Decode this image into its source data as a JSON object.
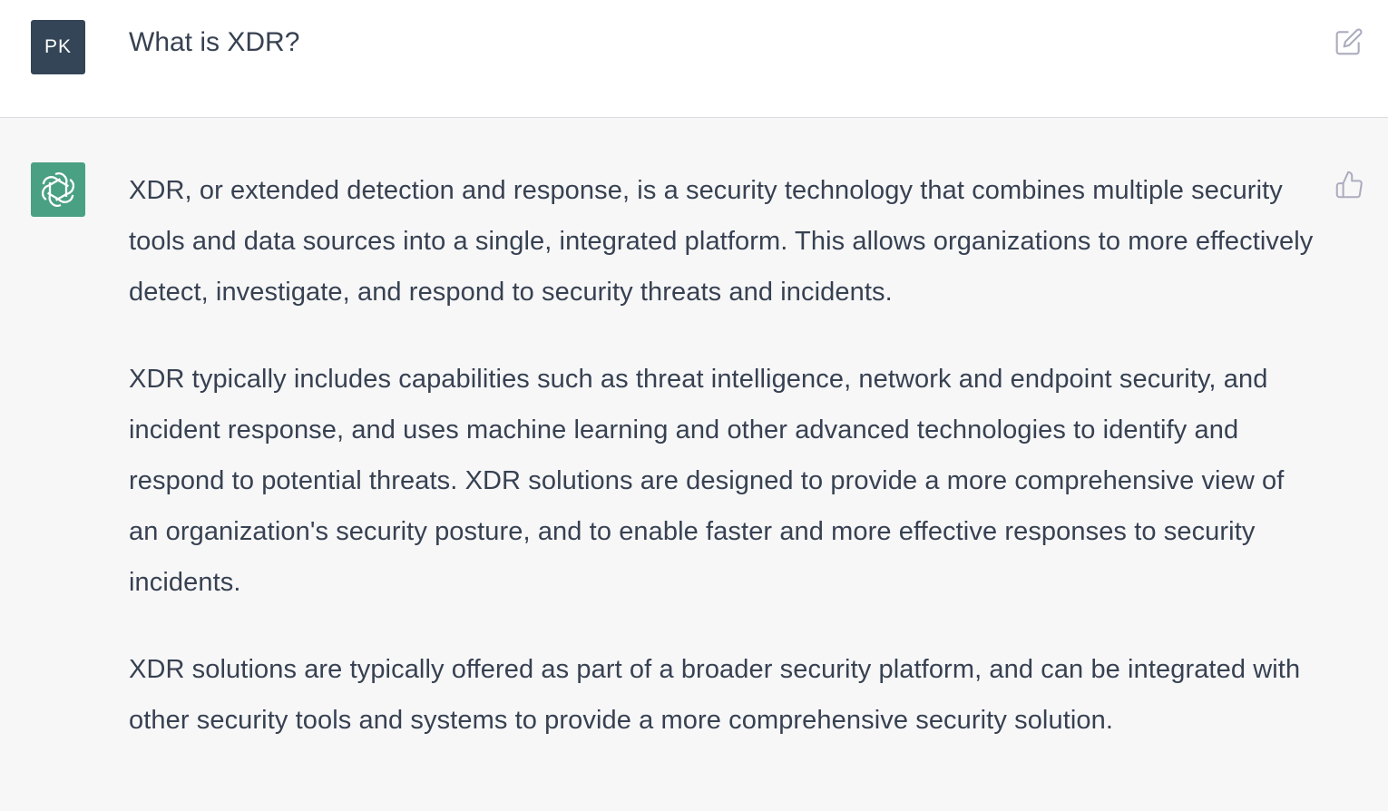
{
  "user": {
    "avatar_initials": "PK",
    "message": "What is XDR?",
    "edit_icon": "edit-icon"
  },
  "assistant": {
    "avatar_icon": "openai-logo-icon",
    "feedback_icon": "thumbs-up-icon",
    "paragraphs": [
      "XDR, or extended detection and response, is a security technology that combines multiple security tools and data sources into a single, integrated platform. This allows organizations to more effectively detect, investigate, and respond to security threats and incidents.",
      "XDR typically includes capabilities such as threat intelligence, network and endpoint security, and incident response, and uses machine learning and other advanced technologies to identify and respond to potential threats. XDR solutions are designed to provide a more comprehensive view of an organization's security posture, and to enable faster and more effective responses to security incidents.",
      "XDR solutions are typically offered as part of a broader security platform, and can be integrated with other security tools and systems to provide a more comprehensive security solution."
    ]
  },
  "colors": {
    "user_avatar_bg": "#334556",
    "assistant_avatar_bg": "#4aa083",
    "assistant_row_bg": "#f7f7f8",
    "text": "#374151",
    "icon": "#acacbe"
  }
}
